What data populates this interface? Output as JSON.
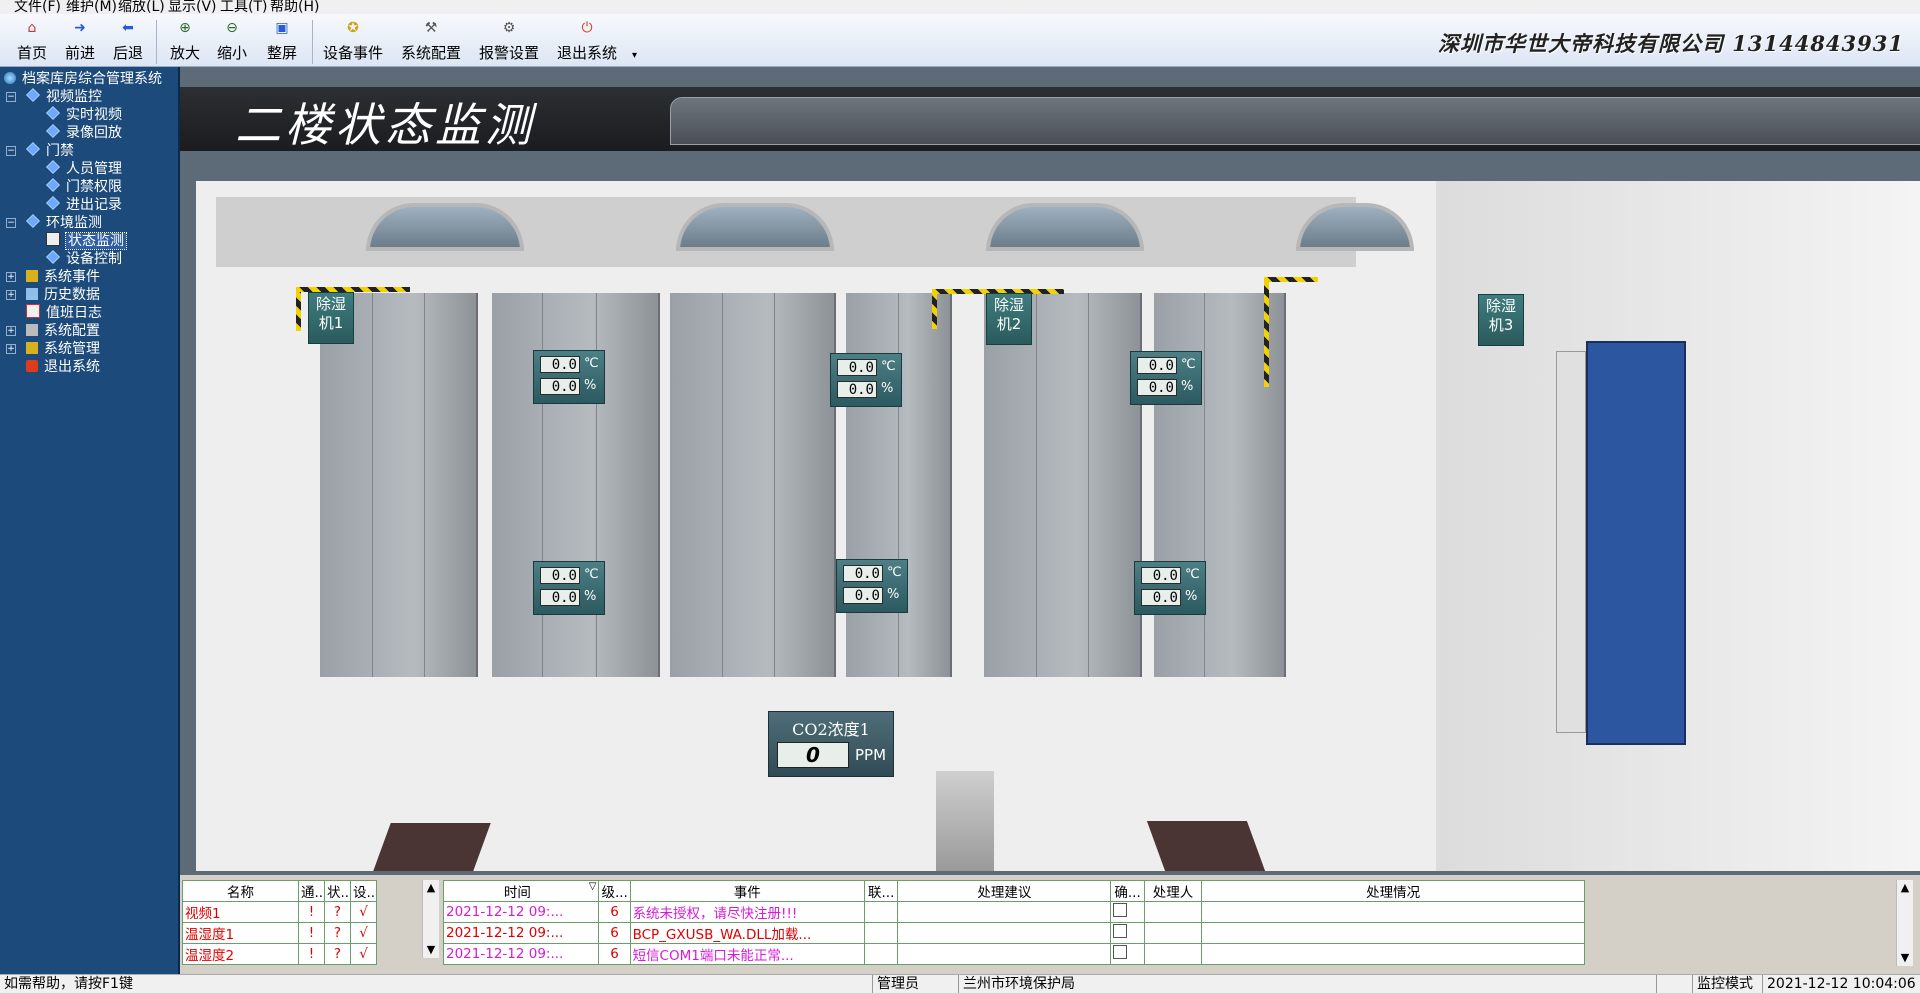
{
  "menu": [
    "文件(F)",
    "维护(M)",
    "缩放(L)",
    "显示(V)",
    "工具(T)",
    "帮助(H)"
  ],
  "toolbar": {
    "buttons": [
      "首页",
      "前进",
      "后退",
      "放大",
      "缩小",
      "整屏",
      "设备事件",
      "系统配置",
      "报警设置",
      "退出系统"
    ],
    "company": "深圳市华世大帝科技有限公司  13144843931"
  },
  "tree": {
    "root": "档案库房综合管理系统",
    "items": [
      "视频监控",
      "实时视频",
      "录像回放",
      "门禁",
      "人员管理",
      "门禁权限",
      "进出记录",
      "环境监测",
      "状态监测",
      "设备控制",
      "系统事件",
      "历史数据",
      "值班日志",
      "系统配置",
      "系统管理",
      "退出系统"
    ]
  },
  "scene": {
    "title": "二楼状态监测",
    "dehumidifiers": [
      "除湿机1",
      "除湿机2",
      "除湿机3"
    ],
    "sensors": [
      {
        "temp": "0.0",
        "hum": "0.0"
      },
      {
        "temp": "0.0",
        "hum": "0.0"
      },
      {
        "temp": "0.0",
        "hum": "0.0"
      },
      {
        "temp": "0.0",
        "hum": "0.0"
      },
      {
        "temp": "0.0",
        "hum": "0.0"
      },
      {
        "temp": "0.0",
        "hum": "0.0"
      }
    ],
    "temp_unit": "℃",
    "hum_unit": "%",
    "co2": {
      "title": "CO2浓度1",
      "value": "0",
      "unit": "PPM"
    }
  },
  "device_grid": {
    "headers": [
      "名称",
      "通...",
      "状...",
      "设..."
    ],
    "rows": [
      [
        "视频1",
        "!",
        "?",
        "√"
      ],
      [
        "温湿度1",
        "!",
        "?",
        "√"
      ],
      [
        "温湿度2",
        "!",
        "?",
        "√"
      ]
    ]
  },
  "event_grid": {
    "headers": [
      "时间",
      "级...",
      "事件",
      "联...",
      "处理建议",
      "确...",
      "处理人",
      "处理情况"
    ],
    "rows": [
      [
        "2021-12-12 09:...",
        "6",
        "系统未授权，请尽快注册!!!"
      ],
      [
        "2021-12-12 09:...",
        "6",
        "BCP_GXUSB_WA.DLL加载..."
      ],
      [
        "2021-12-12 09:...",
        "6",
        "短信COM1端口未能正常..."
      ]
    ]
  },
  "status": {
    "help": "如需帮助，请按F1键",
    "role": "管理员",
    "org": "兰州市环境保护局",
    "mode": "监控模式",
    "datetime": "2021-12-12  10:04:06"
  },
  "colors": {
    "tree_bg": "#1c4a7a",
    "alarm_red": "#e00000",
    "event_magenta": "#d81ad8",
    "panel_teal": "#3f7d7f"
  }
}
